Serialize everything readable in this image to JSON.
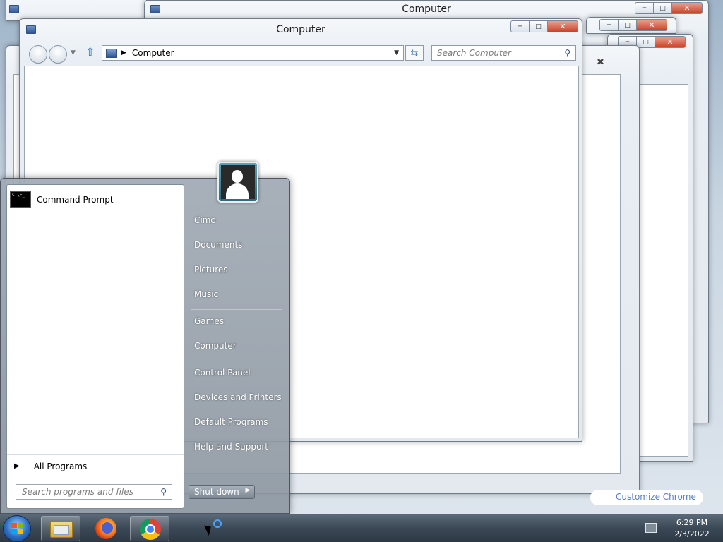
{
  "windows": {
    "back_title": "Computer",
    "front_title": "Computer"
  },
  "explorer": {
    "address_text": "Computer",
    "search_placeholder": "Search Computer"
  },
  "start_menu": {
    "pinned_program": "Command Prompt",
    "all_programs_label": "All Programs",
    "search_placeholder": "Search programs and files",
    "right_items": [
      "Cimo",
      "Documents",
      "Pictures",
      "Music",
      "Games",
      "Computer",
      "Control Panel",
      "Devices and Printers",
      "Default Programs",
      "Help and Support"
    ],
    "shutdown_label": "Shut down"
  },
  "background": {
    "chrome_link": "Customize Chrome"
  },
  "taskbar": {
    "time": "6:29 PM",
    "date": "2/3/2022",
    "apps": [
      "windows-explorer-icon",
      "firefox-icon",
      "chrome-icon"
    ]
  },
  "colors": {
    "close_red": "#c8432a",
    "taskbar_dark": "#3b4856",
    "start_orb": "#2a6cc0"
  }
}
